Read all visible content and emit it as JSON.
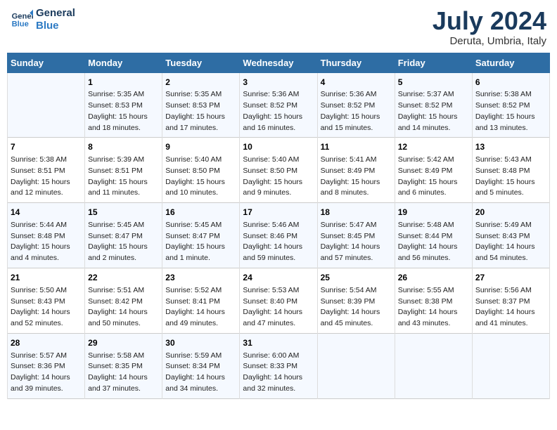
{
  "header": {
    "logo_line1": "General",
    "logo_line2": "Blue",
    "main_title": "July 2024",
    "subtitle": "Deruta, Umbria, Italy"
  },
  "columns": [
    "Sunday",
    "Monday",
    "Tuesday",
    "Wednesday",
    "Thursday",
    "Friday",
    "Saturday"
  ],
  "weeks": [
    {
      "days": [
        {
          "num": "",
          "info": ""
        },
        {
          "num": "1",
          "info": "Sunrise: 5:35 AM\nSunset: 8:53 PM\nDaylight: 15 hours\nand 18 minutes."
        },
        {
          "num": "2",
          "info": "Sunrise: 5:35 AM\nSunset: 8:53 PM\nDaylight: 15 hours\nand 17 minutes."
        },
        {
          "num": "3",
          "info": "Sunrise: 5:36 AM\nSunset: 8:52 PM\nDaylight: 15 hours\nand 16 minutes."
        },
        {
          "num": "4",
          "info": "Sunrise: 5:36 AM\nSunset: 8:52 PM\nDaylight: 15 hours\nand 15 minutes."
        },
        {
          "num": "5",
          "info": "Sunrise: 5:37 AM\nSunset: 8:52 PM\nDaylight: 15 hours\nand 14 minutes."
        },
        {
          "num": "6",
          "info": "Sunrise: 5:38 AM\nSunset: 8:52 PM\nDaylight: 15 hours\nand 13 minutes."
        }
      ]
    },
    {
      "days": [
        {
          "num": "7",
          "info": "Sunrise: 5:38 AM\nSunset: 8:51 PM\nDaylight: 15 hours\nand 12 minutes."
        },
        {
          "num": "8",
          "info": "Sunrise: 5:39 AM\nSunset: 8:51 PM\nDaylight: 15 hours\nand 11 minutes."
        },
        {
          "num": "9",
          "info": "Sunrise: 5:40 AM\nSunset: 8:50 PM\nDaylight: 15 hours\nand 10 minutes."
        },
        {
          "num": "10",
          "info": "Sunrise: 5:40 AM\nSunset: 8:50 PM\nDaylight: 15 hours\nand 9 minutes."
        },
        {
          "num": "11",
          "info": "Sunrise: 5:41 AM\nSunset: 8:49 PM\nDaylight: 15 hours\nand 8 minutes."
        },
        {
          "num": "12",
          "info": "Sunrise: 5:42 AM\nSunset: 8:49 PM\nDaylight: 15 hours\nand 6 minutes."
        },
        {
          "num": "13",
          "info": "Sunrise: 5:43 AM\nSunset: 8:48 PM\nDaylight: 15 hours\nand 5 minutes."
        }
      ]
    },
    {
      "days": [
        {
          "num": "14",
          "info": "Sunrise: 5:44 AM\nSunset: 8:48 PM\nDaylight: 15 hours\nand 4 minutes."
        },
        {
          "num": "15",
          "info": "Sunrise: 5:45 AM\nSunset: 8:47 PM\nDaylight: 15 hours\nand 2 minutes."
        },
        {
          "num": "16",
          "info": "Sunrise: 5:45 AM\nSunset: 8:47 PM\nDaylight: 15 hours\nand 1 minute."
        },
        {
          "num": "17",
          "info": "Sunrise: 5:46 AM\nSunset: 8:46 PM\nDaylight: 14 hours\nand 59 minutes."
        },
        {
          "num": "18",
          "info": "Sunrise: 5:47 AM\nSunset: 8:45 PM\nDaylight: 14 hours\nand 57 minutes."
        },
        {
          "num": "19",
          "info": "Sunrise: 5:48 AM\nSunset: 8:44 PM\nDaylight: 14 hours\nand 56 minutes."
        },
        {
          "num": "20",
          "info": "Sunrise: 5:49 AM\nSunset: 8:43 PM\nDaylight: 14 hours\nand 54 minutes."
        }
      ]
    },
    {
      "days": [
        {
          "num": "21",
          "info": "Sunrise: 5:50 AM\nSunset: 8:43 PM\nDaylight: 14 hours\nand 52 minutes."
        },
        {
          "num": "22",
          "info": "Sunrise: 5:51 AM\nSunset: 8:42 PM\nDaylight: 14 hours\nand 50 minutes."
        },
        {
          "num": "23",
          "info": "Sunrise: 5:52 AM\nSunset: 8:41 PM\nDaylight: 14 hours\nand 49 minutes."
        },
        {
          "num": "24",
          "info": "Sunrise: 5:53 AM\nSunset: 8:40 PM\nDaylight: 14 hours\nand 47 minutes."
        },
        {
          "num": "25",
          "info": "Sunrise: 5:54 AM\nSunset: 8:39 PM\nDaylight: 14 hours\nand 45 minutes."
        },
        {
          "num": "26",
          "info": "Sunrise: 5:55 AM\nSunset: 8:38 PM\nDaylight: 14 hours\nand 43 minutes."
        },
        {
          "num": "27",
          "info": "Sunrise: 5:56 AM\nSunset: 8:37 PM\nDaylight: 14 hours\nand 41 minutes."
        }
      ]
    },
    {
      "days": [
        {
          "num": "28",
          "info": "Sunrise: 5:57 AM\nSunset: 8:36 PM\nDaylight: 14 hours\nand 39 minutes."
        },
        {
          "num": "29",
          "info": "Sunrise: 5:58 AM\nSunset: 8:35 PM\nDaylight: 14 hours\nand 37 minutes."
        },
        {
          "num": "30",
          "info": "Sunrise: 5:59 AM\nSunset: 8:34 PM\nDaylight: 14 hours\nand 34 minutes."
        },
        {
          "num": "31",
          "info": "Sunrise: 6:00 AM\nSunset: 8:33 PM\nDaylight: 14 hours\nand 32 minutes."
        },
        {
          "num": "",
          "info": ""
        },
        {
          "num": "",
          "info": ""
        },
        {
          "num": "",
          "info": ""
        }
      ]
    }
  ]
}
